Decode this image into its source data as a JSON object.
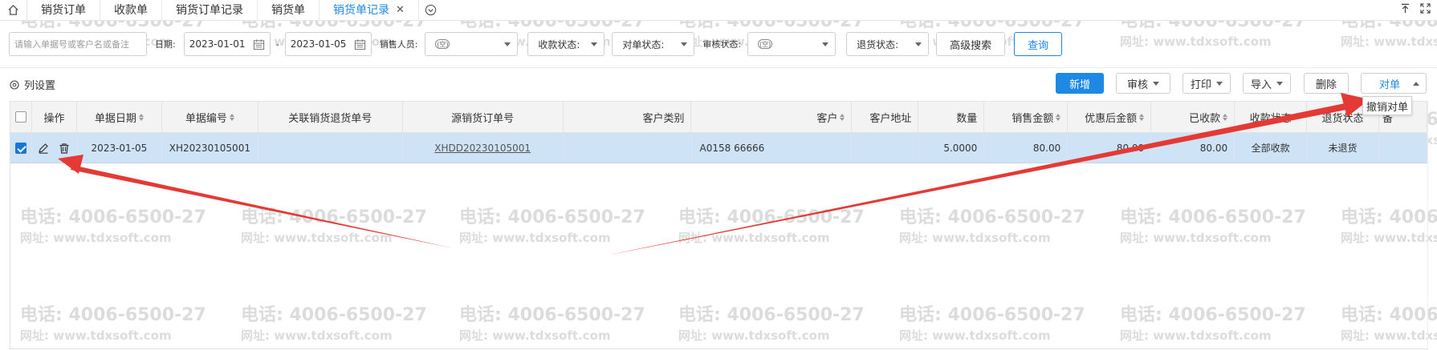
{
  "tabs": {
    "items": [
      {
        "label": "销货订单"
      },
      {
        "label": "收款单"
      },
      {
        "label": "销货订单记录"
      },
      {
        "label": "销货单"
      },
      {
        "label": "销货单记录",
        "active": true,
        "close": "✕"
      }
    ]
  },
  "filters": {
    "search_placeholder": "请输入单据号或客户名或备注",
    "date_label": "日期:",
    "date_from": "2023-01-01",
    "date_sep": "-",
    "date_to": "2023-01-05",
    "salesperson_label": "销售人员:",
    "salesperson_tag": "(空)",
    "payment_status": "收款状态:",
    "reconcile_status": "对单状态:",
    "audit_label": "审核状态:",
    "audit_tag": "(空)",
    "return_status": "退货状态:",
    "advanced_search": "高级搜索",
    "query": "查询"
  },
  "toolbar": {
    "column_settings": "列设置",
    "add": "新增",
    "audit": "审核",
    "print": "打印",
    "import": "导入",
    "delete": "删除",
    "reconcile": "对单",
    "menu_item": "撤销对单"
  },
  "table": {
    "headers": {
      "op": "操作",
      "date": "单据日期",
      "no": "单据编号",
      "return_no": "关联销货退货单号",
      "source_order": "源销货订单号",
      "cust_type": "客户类别",
      "customer": "客户",
      "address": "客户地址",
      "qty": "数量",
      "amount": "销售金额",
      "discounted": "优惠后金额",
      "received": "已收款",
      "pay_status": "收款状态",
      "return_status": "退货状态",
      "last": "备"
    },
    "rows": [
      {
        "date": "2023-01-05",
        "no": "XH20230105001",
        "return_no": "",
        "source_order": "XHDD20230105001",
        "cust_type": "",
        "customer": "A0158 66666",
        "address": "",
        "qty": "5.0000",
        "amount": "80.00",
        "discounted": "80.00",
        "received": "80.00",
        "pay_status": "全部收款",
        "return_status": "未退货"
      }
    ]
  },
  "watermark": {
    "phone": "电话: 4006-6500-27",
    "site": "网址: www.tdxsoft.com"
  },
  "colors": {
    "accent": "#1e88e5",
    "selected_row": "#cfe3f7",
    "arrow": "#e53935"
  },
  "icons": [
    "home-icon",
    "chevron-circle-down-icon",
    "pin-top-icon",
    "fullscreen-icon",
    "calendar-icon",
    "settings-circle-icon",
    "edit-icon",
    "trash-icon"
  ]
}
